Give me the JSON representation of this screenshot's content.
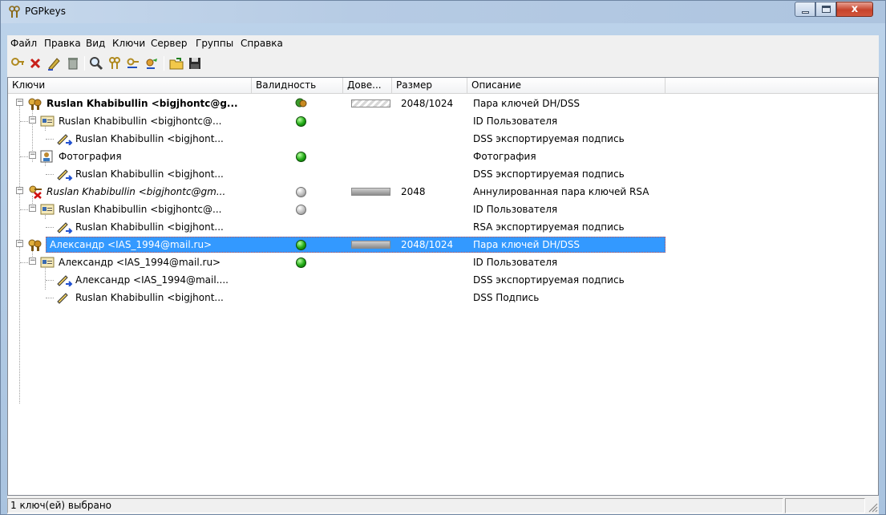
{
  "window": {
    "title": "PGPkeys",
    "close_label": "x"
  },
  "menu": [
    "Файл",
    "Правка",
    "Вид",
    "Ключи",
    "Сервер",
    "Группы",
    "Справка"
  ],
  "toolbar": [
    "new-key-icon",
    "delete-icon",
    "sign-icon",
    "revoke-icon",
    "search-icon",
    "key-properties-icon",
    "keyserver-send-icon",
    "keyserver-get-icon",
    "import-icon",
    "export-icon"
  ],
  "columns": [
    "Ключи",
    "Валидность",
    "Дове...",
    "Размер",
    "Описание"
  ],
  "rows": [
    {
      "name": "Ruslan Khabibullin <bigjhontc@g...",
      "size": "2048/1024",
      "desc": "Пара ключей DH/DSS"
    },
    {
      "name": "Ruslan Khabibullin <bigjhontc@...",
      "size": "",
      "desc": "ID Пользователя"
    },
    {
      "name": "Ruslan Khabibullin <bigjhont...",
      "size": "",
      "desc": "DSS экспортируемая подпись"
    },
    {
      "name": "Фотография",
      "size": "",
      "desc": "Фотография"
    },
    {
      "name": "Ruslan Khabibullin <bigjhont...",
      "size": "",
      "desc": "DSS экспортируемая подпись"
    },
    {
      "name": "Ruslan Khabibullin <bigjhontc@gm...",
      "size": "2048",
      "desc": "Аннулированная пара ключей RSA"
    },
    {
      "name": "Ruslan Khabibullin <bigjhontc@...",
      "size": "",
      "desc": "ID Пользователя"
    },
    {
      "name": "Ruslan Khabibullin <bigjhont...",
      "size": "",
      "desc": "RSA экспортируемая подпись"
    },
    {
      "name": "Александр <IAS_1994@mail.ru>",
      "size": "2048/1024",
      "desc": "Пара ключей DH/DSS"
    },
    {
      "name": "Александр <IAS_1994@mail.ru>",
      "size": "",
      "desc": "ID Пользователя"
    },
    {
      "name": "Александр <IAS_1994@mail....",
      "size": "",
      "desc": "DSS экспортируемая подпись"
    },
    {
      "name": "Ruslan Khabibullin <bigjhont...",
      "size": "",
      "desc": "DSS Подпись"
    }
  ],
  "status": {
    "text": "1 ключ(ей) выбрано"
  },
  "colors": {
    "selection": "#3399ff",
    "valid": "#1fa814",
    "invalid": "#bdbdbd"
  }
}
